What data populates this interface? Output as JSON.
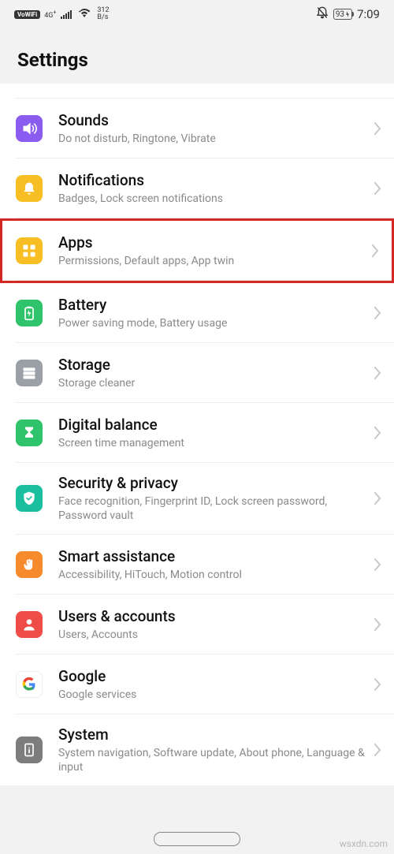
{
  "status": {
    "vowifi": "VoWiFi",
    "net_gen": "4G",
    "speed_top": "312",
    "speed_bot": "B/s",
    "battery": "93",
    "time": "7:09"
  },
  "page_title": "Settings",
  "items": [
    {
      "key": "sounds",
      "title": "Sounds",
      "sub": "Do not disturb, Ringtone, Vibrate",
      "bg": "bg-purple",
      "icon": "sound",
      "highlighted": false
    },
    {
      "key": "notifications",
      "title": "Notifications",
      "sub": "Badges, Lock screen notifications",
      "bg": "bg-yellow",
      "icon": "bell",
      "highlighted": false
    },
    {
      "key": "apps",
      "title": "Apps",
      "sub": "Permissions, Default apps, App twin",
      "bg": "bg-yellow",
      "icon": "grid",
      "highlighted": true
    },
    {
      "key": "battery",
      "title": "Battery",
      "sub": "Power saving mode, Battery usage",
      "bg": "bg-green",
      "icon": "battery",
      "highlighted": false
    },
    {
      "key": "storage",
      "title": "Storage",
      "sub": "Storage cleaner",
      "bg": "bg-gray",
      "icon": "storage",
      "highlighted": false
    },
    {
      "key": "digital_balance",
      "title": "Digital balance",
      "sub": "Screen time management",
      "bg": "bg-green",
      "icon": "hourglass",
      "highlighted": false
    },
    {
      "key": "security",
      "title": "Security & privacy",
      "sub": "Face recognition, Fingerprint ID, Lock screen password, Password vault",
      "bg": "bg-teal",
      "icon": "shield",
      "highlighted": false
    },
    {
      "key": "smart_assist",
      "title": "Smart assistance",
      "sub": "Accessibility, HiTouch, Motion control",
      "bg": "bg-orange",
      "icon": "hand",
      "highlighted": false
    },
    {
      "key": "users",
      "title": "Users & accounts",
      "sub": "Users, Accounts",
      "bg": "bg-red",
      "icon": "user",
      "highlighted": false
    },
    {
      "key": "google",
      "title": "Google",
      "sub": "Google services",
      "bg": "bg-white",
      "icon": "google",
      "highlighted": false
    },
    {
      "key": "system",
      "title": "System",
      "sub": "System navigation, Software update, About phone, Language & input",
      "bg": "bg-darkgray",
      "icon": "info",
      "highlighted": false
    }
  ],
  "watermark": "wsxdn.com"
}
